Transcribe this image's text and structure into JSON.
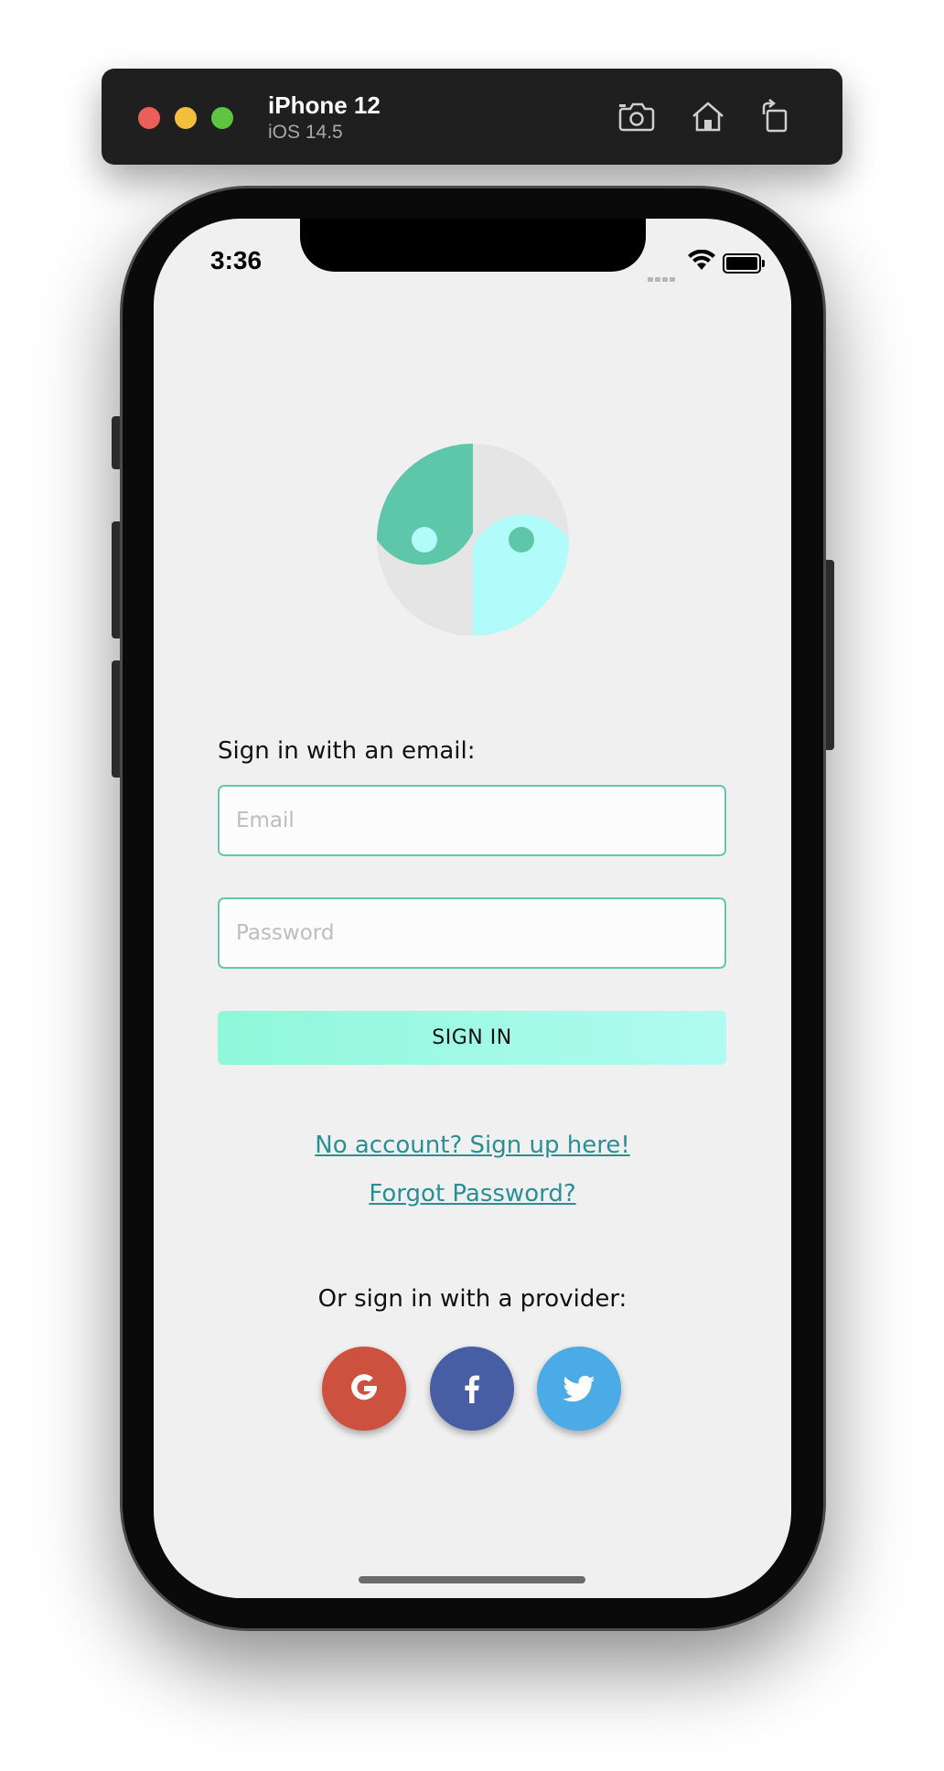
{
  "simulator": {
    "device_name": "iPhone 12",
    "os_version": "iOS 14.5",
    "toolbar_icons": [
      "screenshot-icon",
      "home-icon",
      "rotate-icon"
    ]
  },
  "status_bar": {
    "time": "3:36",
    "icons": [
      "signal-icon",
      "wifi-icon",
      "battery-icon"
    ]
  },
  "logo": {
    "name": "yin-yang-logo-icon",
    "colors": {
      "left": "#5ec7aa",
      "right": "#b1fbfb",
      "background": "#e5e5e5"
    }
  },
  "email_section": {
    "label": "Sign in with an email:",
    "email_placeholder": "Email",
    "email_value": "",
    "password_placeholder": "Password",
    "password_value": "",
    "signin_label": "SIGN IN"
  },
  "links": {
    "signup": "No account? Sign up here!",
    "forgot": "Forgot Password?"
  },
  "providers": {
    "label": "Or sign in with a provider:",
    "items": [
      {
        "name": "google",
        "icon": "google-icon",
        "color": "#cc513f"
      },
      {
        "name": "facebook",
        "icon": "facebook-icon",
        "color": "#475ea4"
      },
      {
        "name": "twitter",
        "icon": "twitter-icon",
        "color": "#4aabe7"
      }
    ]
  },
  "colors": {
    "accent": "#62c9ac",
    "link": "#2a8f94",
    "button_gradient_start": "#8ff8d9",
    "button_gradient_end": "#b0fbf1"
  }
}
